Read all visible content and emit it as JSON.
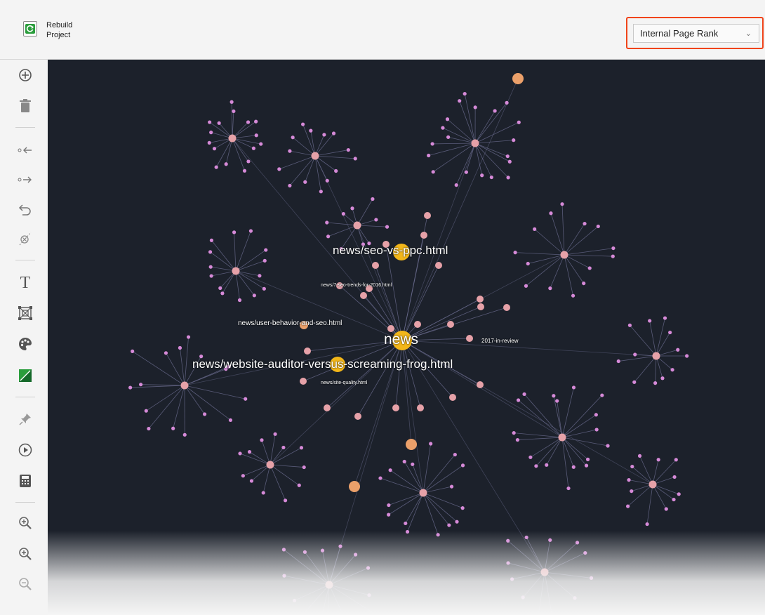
{
  "toolbar": {
    "rebuild_line1": "Rebuild",
    "rebuild_line2": "Project",
    "dropdown_value": "Internal Page Rank"
  },
  "sidebar_tools": [
    {
      "name": "add-icon"
    },
    {
      "name": "trash-icon"
    },
    {
      "name": "links-in-icon"
    },
    {
      "name": "links-out-icon"
    },
    {
      "name": "undo-icon"
    },
    {
      "name": "hide-node-icon"
    },
    {
      "name": "text-icon"
    },
    {
      "name": "layout-icon"
    },
    {
      "name": "palette-icon"
    },
    {
      "name": "color-scheme-icon"
    },
    {
      "name": "pin-icon"
    },
    {
      "name": "play-icon"
    },
    {
      "name": "calculator-icon"
    },
    {
      "name": "zoom-in-icon"
    },
    {
      "name": "zoom-fit-icon"
    },
    {
      "name": "zoom-out-icon"
    }
  ],
  "graph_labels": {
    "news": "news",
    "seo_vs_ppc": "news/seo-vs-ppc.html",
    "website_auditor": "news/website-auditor-versus-screaming-frog.html",
    "user_behavior": "news/user-behavior-and-seo.html",
    "seo_trends": "news/7-seo-trends-for-2016.html",
    "site_quality": "news/site-quality.html",
    "review_2017": "2017-in-review"
  },
  "colors": {
    "canvas_bg": "#1c212b",
    "edge": "#6d6f93",
    "node_small": "#d68ad8",
    "node_hub": "#e6a1a8",
    "node_orange": "#eba06a",
    "node_main": "#f2b619",
    "highlight_border": "#f0441a",
    "accent_green": "#2a9d3c"
  }
}
